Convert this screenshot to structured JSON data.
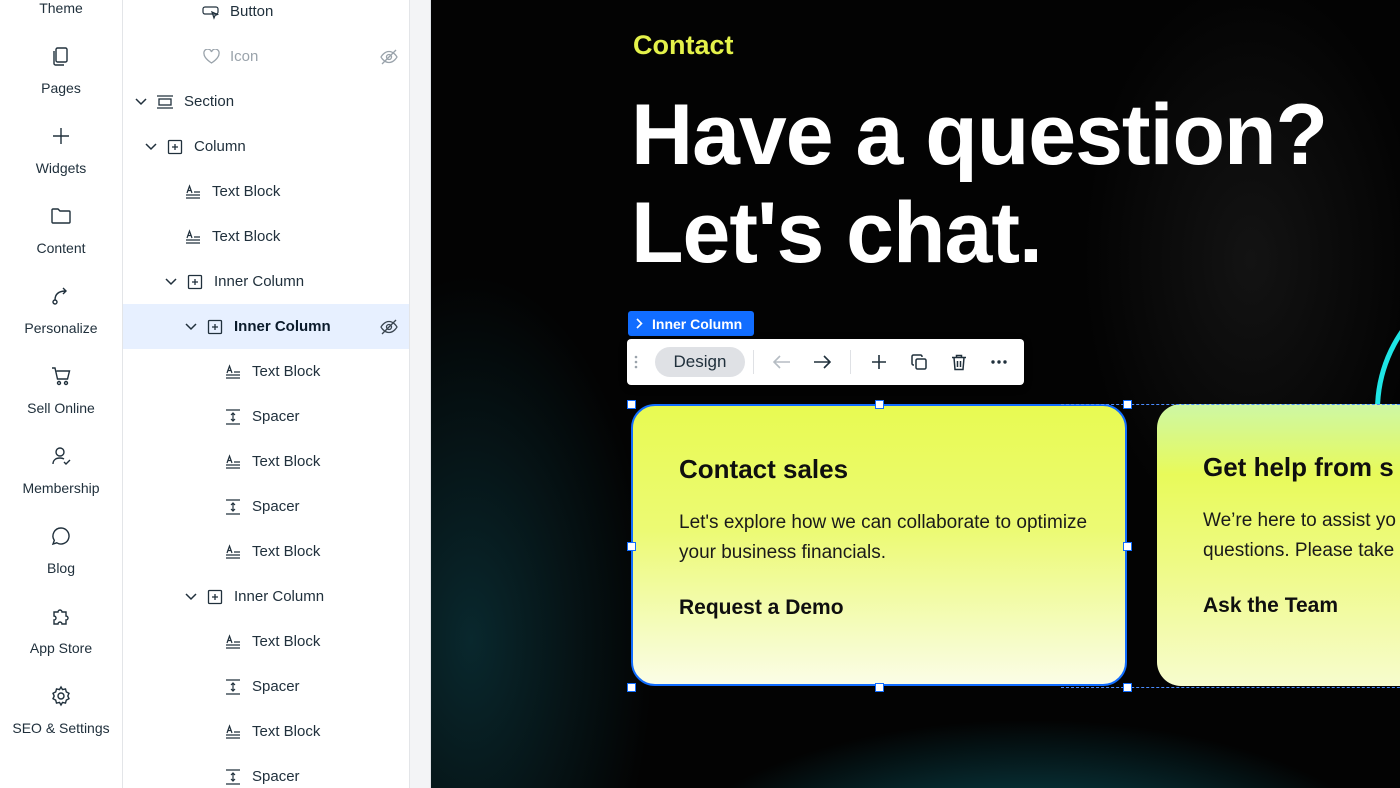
{
  "rail": {
    "items": [
      {
        "label": "Theme",
        "icon": "theme-icon"
      },
      {
        "label": "Pages",
        "icon": "pages-icon"
      },
      {
        "label": "Widgets",
        "icon": "plus-icon"
      },
      {
        "label": "Content",
        "icon": "folder-icon"
      },
      {
        "label": "Personalize",
        "icon": "personalize-icon"
      },
      {
        "label": "Sell Online",
        "icon": "cart-icon"
      },
      {
        "label": "Membership",
        "icon": "member-icon"
      },
      {
        "label": "Blog",
        "icon": "chat-bubble-icon"
      },
      {
        "label": "App Store",
        "icon": "puzzle-icon"
      },
      {
        "label": "SEO & Settings",
        "icon": "gear-icon"
      }
    ]
  },
  "layers": {
    "rows": [
      {
        "label": "Button",
        "icon": "button-icon"
      },
      {
        "label": "Icon",
        "icon": "heart-icon",
        "hidden": true
      },
      {
        "label": "Section",
        "icon": "section-icon",
        "expanded": true
      },
      {
        "label": "Column",
        "icon": "column-icon",
        "expanded": true
      },
      {
        "label": "Text Block",
        "icon": "text-block-icon"
      },
      {
        "label": "Text Block",
        "icon": "text-block-icon"
      },
      {
        "label": "Inner Column",
        "icon": "column-icon",
        "expanded": true
      },
      {
        "label": "Inner Column",
        "icon": "column-icon",
        "expanded": true,
        "selected": true,
        "hidden": true
      },
      {
        "label": "Text Block",
        "icon": "text-block-icon"
      },
      {
        "label": "Spacer",
        "icon": "spacer-icon"
      },
      {
        "label": "Text Block",
        "icon": "text-block-icon"
      },
      {
        "label": "Spacer",
        "icon": "spacer-icon"
      },
      {
        "label": "Text Block",
        "icon": "text-block-icon"
      },
      {
        "label": "Inner Column",
        "icon": "column-icon",
        "expanded": true
      },
      {
        "label": "Text Block",
        "icon": "text-block-icon"
      },
      {
        "label": "Spacer",
        "icon": "spacer-icon"
      },
      {
        "label": "Text Block",
        "icon": "text-block-icon"
      },
      {
        "label": "Spacer",
        "icon": "spacer-icon"
      }
    ]
  },
  "canvas": {
    "eyebrow": "Contact",
    "headline_line1": "Have a question?",
    "headline_line2": "Let's chat.",
    "selection_tag": "Inner Column",
    "toolbar": {
      "design_label": "Design"
    },
    "cards": [
      {
        "title": "Contact sales",
        "body": "Let's explore how we can collaborate to optimize your business financials.",
        "link": "Request a Demo"
      },
      {
        "title": "Get help from s",
        "body_line1": "We’re here to assist yo",
        "body_line2": "questions. Please take",
        "link": "Ask the Team"
      }
    ]
  },
  "colors": {
    "accent": "#116dff",
    "eyebrow": "#e4f24a",
    "canvas_bg": "#030303",
    "selected_row": "#e7f0ff"
  }
}
